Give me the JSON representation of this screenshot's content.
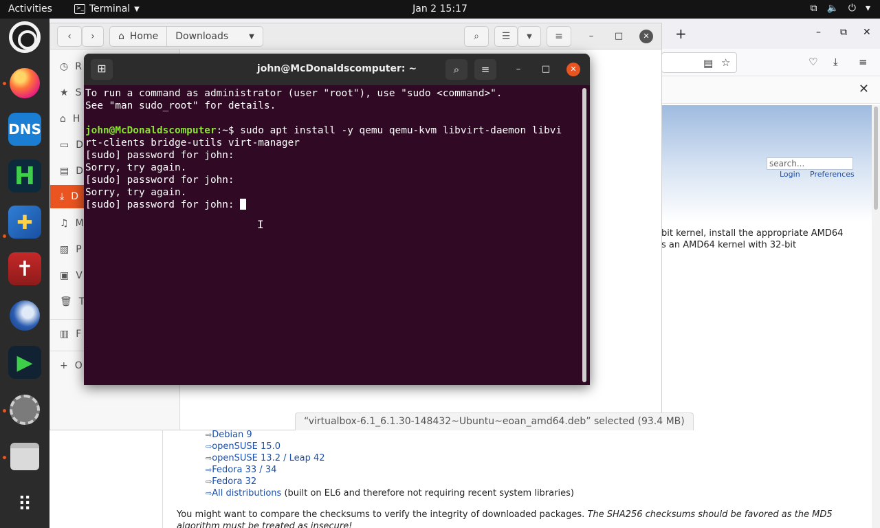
{
  "topbar": {
    "activities": "Activities",
    "app_name": "Terminal",
    "datetime": "Jan 2  15:17"
  },
  "dock": {
    "items": [
      "ubuntu",
      "firefox",
      "dns",
      "h",
      "book",
      "bible",
      "thunderbird",
      "screencast",
      "settings",
      "files",
      "show-apps"
    ],
    "dns_label": "DNS",
    "h_label": "H"
  },
  "files": {
    "path_home": "Home",
    "path_downloads": "Downloads",
    "sidebar": [
      {
        "label": "R",
        "icon": "clock-icon"
      },
      {
        "label": "S",
        "icon": "star-icon"
      },
      {
        "label": "H",
        "icon": "home-icon"
      },
      {
        "label": "D",
        "icon": "desktop-icon"
      },
      {
        "label": "D",
        "icon": "document-icon"
      },
      {
        "label": "D",
        "icon": "download-icon"
      },
      {
        "label": "M",
        "icon": "music-icon"
      },
      {
        "label": "P",
        "icon": "picture-icon"
      },
      {
        "label": "V",
        "icon": "video-icon"
      },
      {
        "label": "T",
        "icon": "trash-icon"
      },
      {
        "label": "F",
        "icon": "floppy-icon"
      },
      {
        "label": "O",
        "icon": "plus-icon"
      }
    ],
    "status": "“virtualbox-6.1_6.1.30-148432~Ubuntu~eoan_amd64.deb” selected  (93.4 MB)"
  },
  "firefox": {
    "search_placeholder": "search...",
    "login": "Login",
    "preferences": "Preferences",
    "para_line1": "bit kernel, install the appropriate AMD64",
    "para_line2": "s an AMD64 kernel with 32-bit",
    "distributions": [
      {
        "name": "Debian 9",
        "suffix": ""
      },
      {
        "name": "openSUSE 15.0",
        "suffix": ""
      },
      {
        "name": "openSUSE 13.2 / Leap 42",
        "suffix": ""
      },
      {
        "name": "Fedora 33 / 34",
        "suffix": ""
      },
      {
        "name": "Fedora 32",
        "suffix": ""
      },
      {
        "name": "All distributions",
        "suffix": " (built on EL6 and therefore not requiring recent system libraries)"
      }
    ],
    "checksum_plain": "You might want to compare the checksums to verify the integrity of downloaded packages. ",
    "checksum_italic": "The SHA256 checksums should be favored as the MD5",
    "checksum_line2": "algorithm must be treated as insecure!"
  },
  "terminal": {
    "title": "john@McDonaldscomputer: ~",
    "lines": {
      "l1": "To run a command as administrator (user \"root\"), use \"sudo <command>\".",
      "l2": "See \"man sudo_root\" for details.",
      "prompt_user": "john@McDonaldscomputer",
      "prompt_sep": ":~$ ",
      "command_a": "sudo apt install -y qemu qemu-kvm libvirt-daemon libvi",
      "command_b": "rt-clients bridge-utils virt-manager",
      "p1": "[sudo] password for john:",
      "s1": "Sorry, try again.",
      "p2": "[sudo] password for john:",
      "s2": "Sorry, try again.",
      "p3": "[sudo] password for john: "
    }
  }
}
